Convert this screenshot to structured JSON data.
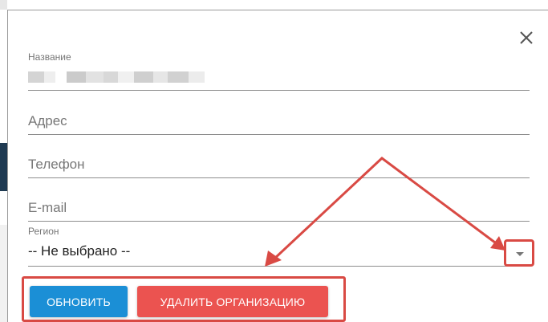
{
  "dialog": {
    "close_icon_name": "close-icon"
  },
  "form": {
    "name": {
      "label": "Название",
      "value_redacted": true
    },
    "address": {
      "placeholder": "Адрес"
    },
    "phone": {
      "placeholder": "Телефон"
    },
    "email": {
      "placeholder": "E-mail"
    },
    "region": {
      "label": "Регион",
      "selected": "-- Не выбрано --",
      "arrow_icon_name": "caret-down-icon"
    }
  },
  "actions": {
    "update_label": "ОБНОВИТЬ",
    "delete_label": "УДАЛИТЬ ОРГАНИЗАЦИЮ"
  },
  "colors": {
    "update_button": "#1b8fd6",
    "delete_button": "#eb5350",
    "annotation": "#d94a44"
  }
}
